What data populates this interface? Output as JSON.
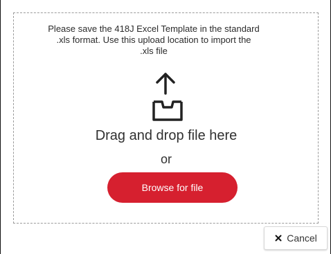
{
  "dropzone": {
    "instruction_text": "Please save the 418J Excel Template in the standard\n.xls format. Use this upload location to import the\n.xls file",
    "upload_icon": "upload-icon",
    "drag_text": "Drag and drop file here",
    "or_text": "or",
    "browse_label": "Browse for file"
  },
  "footer": {
    "cancel_label": "Cancel",
    "cancel_icon": "close-icon"
  },
  "colors": {
    "accent": "#d6202f",
    "border": "#9a9a9a",
    "text": "#303030",
    "background": "#ffffff"
  }
}
